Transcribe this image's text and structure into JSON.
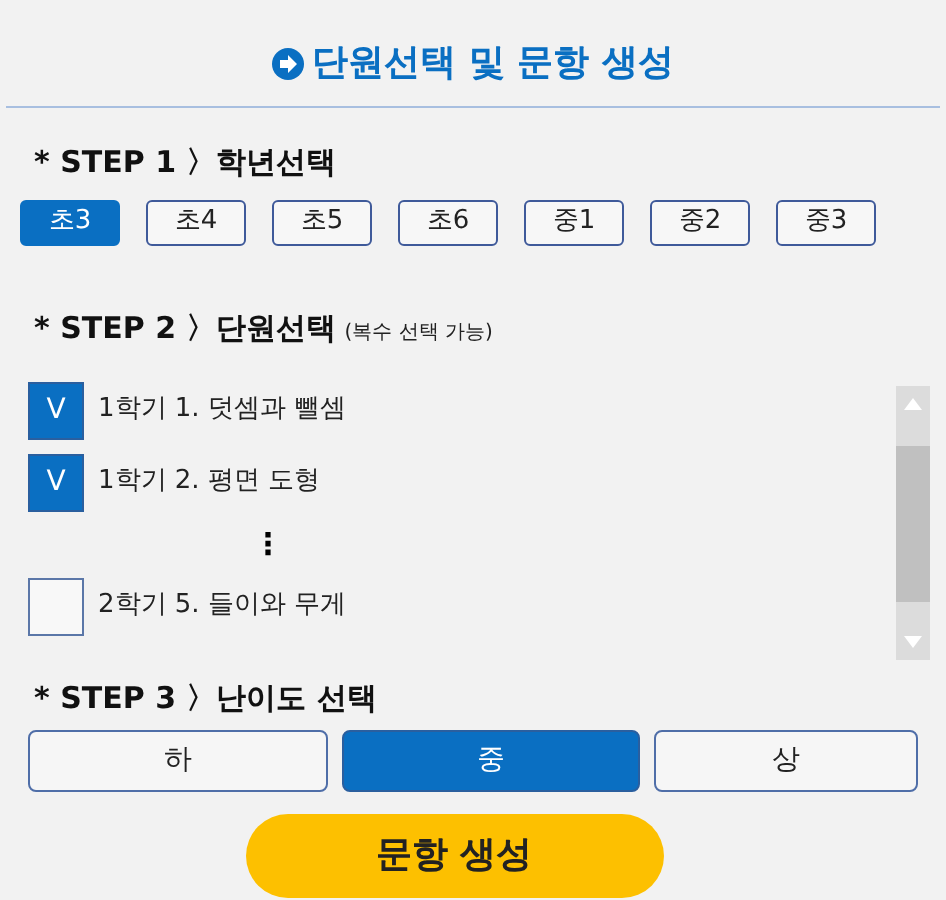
{
  "title": "단원선택 및 문항 생성",
  "step1": {
    "heading": "* STEP 1 〉학년선택",
    "grades": [
      {
        "label": "초3",
        "selected": true
      },
      {
        "label": "초4",
        "selected": false
      },
      {
        "label": "초5",
        "selected": false
      },
      {
        "label": "초6",
        "selected": false
      },
      {
        "label": "중1",
        "selected": false
      },
      {
        "label": "중2",
        "selected": false
      },
      {
        "label": "중3",
        "selected": false
      }
    ]
  },
  "step2": {
    "heading": "* STEP 2 〉단원선택",
    "note": "(복수 선택 가능)",
    "units": [
      {
        "kind": "unit",
        "label": "1학기 1. 덧셈과 뺄셈",
        "checked": true,
        "mark": "V"
      },
      {
        "kind": "unit",
        "label": "1학기 2. 평면 도형",
        "checked": true,
        "mark": "V"
      },
      {
        "kind": "more",
        "text": "⋮"
      },
      {
        "kind": "unit",
        "label": "2학기 5. 들이와 무게",
        "checked": false
      }
    ]
  },
  "step3": {
    "heading": "* STEP 3 〉난이도 선택",
    "levels": [
      {
        "label": "하",
        "selected": false
      },
      {
        "label": "중",
        "selected": true
      },
      {
        "label": "상",
        "selected": false
      }
    ]
  },
  "generate_button": "문항 생성"
}
